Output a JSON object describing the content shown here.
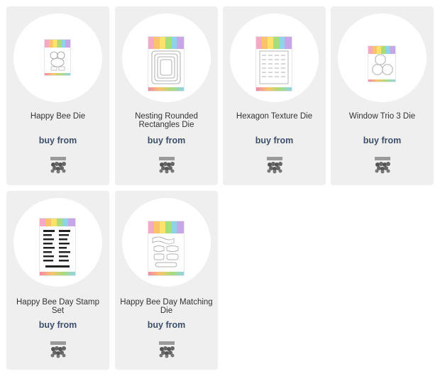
{
  "products": [
    {
      "name": "Happy Bee Die",
      "buy_label": "buy from",
      "retailer_icon": "retailer-logo-icon"
    },
    {
      "name": "Nesting Rounded Rectangles Die",
      "buy_label": "buy from",
      "retailer_icon": "retailer-logo-icon"
    },
    {
      "name": "Hexagon Texture Die",
      "buy_label": "buy from",
      "retailer_icon": "retailer-logo-icon"
    },
    {
      "name": "Window Trio 3 Die",
      "buy_label": "buy from",
      "retailer_icon": "retailer-logo-icon"
    },
    {
      "name": "Happy Bee Day Stamp Set",
      "buy_label": "buy from",
      "retailer_icon": "retailer-logo-icon"
    },
    {
      "name": "Happy Bee Day Matching Die",
      "buy_label": "buy from",
      "retailer_icon": "retailer-logo-icon"
    }
  ],
  "colors": {
    "card_bg": "#efefef",
    "buy_text": "#3d4f6a",
    "name_text": "#333333"
  }
}
